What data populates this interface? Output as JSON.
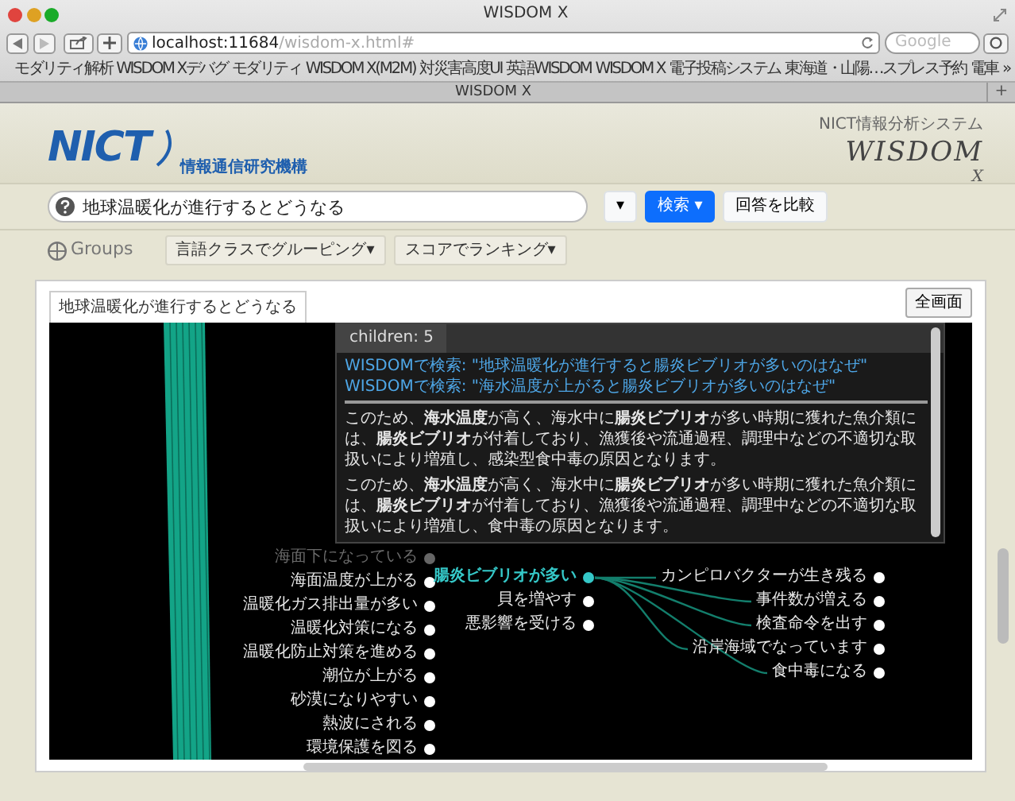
{
  "browser": {
    "title": "WISDOM X",
    "url_host": "localhost:11684",
    "url_path": "/wisdom-x.html#",
    "search_placeholder": "Google",
    "bookmarks": [
      "モダリティ解析",
      "WISDOM Xデバグ",
      "モダリティ",
      "WISDOM X(M2M)",
      "対災害高度UI",
      "英語WISDOM",
      "WISDOM X",
      "電子投稿システム",
      "東海道・山陽…スプレス予約",
      "電車"
    ],
    "bookmarks_more": "»",
    "tab": "WISDOM X",
    "new_tab": "+"
  },
  "header": {
    "org_logo": "NICT",
    "org_name": "情報通信研究機構",
    "system_label": "NICT情報分析システム",
    "product_logo": "WISDOM",
    "product_suffix": "X"
  },
  "search": {
    "value": "地球温暖化が進行するとどうなる",
    "buttons": [
      {
        "label": "▾",
        "kind": "dropdown"
      },
      {
        "label": "検索 ▾",
        "kind": "primary"
      },
      {
        "label": "回答を比較",
        "kind": "default"
      }
    ]
  },
  "groups": {
    "label": "Groups",
    "buttons": [
      "言語クラスでグルーピング▾",
      "スコアでランキング▾"
    ]
  },
  "panel": {
    "tab": "地球温暖化が進行するとどうなる",
    "fullscreen": "全画面",
    "popup": {
      "tab": "children: 5",
      "links": [
        "WISDOMで検索: \"地球温暖化が進行すると腸炎ビブリオが多いのはなぜ\"",
        "WISDOMで検索: \"海水温度が上がると腸炎ビブリオが多いのはなぜ\""
      ],
      "paragraphs": [
        "このため、**海水温度**が高く、海水中に**腸炎ビブリオ**が多い時期に獲れた魚介類には、**腸炎ビブリオ**が付着しており、漁獲後や流通過程、調理中などの不適切な取扱いにより増殖し、感染型食中毒の原因となります。",
        "このため、**海水温度**が高く、海水中に**腸炎ビブリオ**が多い時期に獲れた魚介類には、**腸炎ビブリオ**が付着しており、漁獲後や流通過程、調理中などの不適切な取扱いにより増殖し、食中毒の原因となります。"
      ]
    },
    "tree": {
      "left": [
        {
          "label": "海面下になっている",
          "kind": "faded"
        },
        {
          "label": "海面温度が上がる",
          "kind": "normal"
        },
        {
          "label": "温暖化ガス排出量が多い",
          "kind": "normal"
        },
        {
          "label": "温暖化対策になる",
          "kind": "normal"
        },
        {
          "label": "温暖化防止対策を進める",
          "kind": "normal"
        },
        {
          "label": "潮位が上がる",
          "kind": "normal"
        },
        {
          "label": "砂漠になりやすい",
          "kind": "normal"
        },
        {
          "label": "熱波にされる",
          "kind": "normal"
        },
        {
          "label": "環境保護を図る",
          "kind": "normal"
        }
      ],
      "middle": [
        {
          "label": "腸炎ビブリオが多い",
          "kind": "strong"
        },
        {
          "label": "貝を増やす",
          "kind": "normal"
        },
        {
          "label": "悪影響を受ける",
          "kind": "normal"
        }
      ],
      "right": [
        {
          "label": "カンピロバクターが生き残る",
          "kind": "normal"
        },
        {
          "label": "事件数が増える",
          "kind": "normal"
        },
        {
          "label": "検査命令を出す",
          "kind": "normal"
        },
        {
          "label": "沿岸海域でなっています",
          "kind": "normal"
        },
        {
          "label": "食中毒になる",
          "kind": "normal"
        }
      ]
    }
  }
}
